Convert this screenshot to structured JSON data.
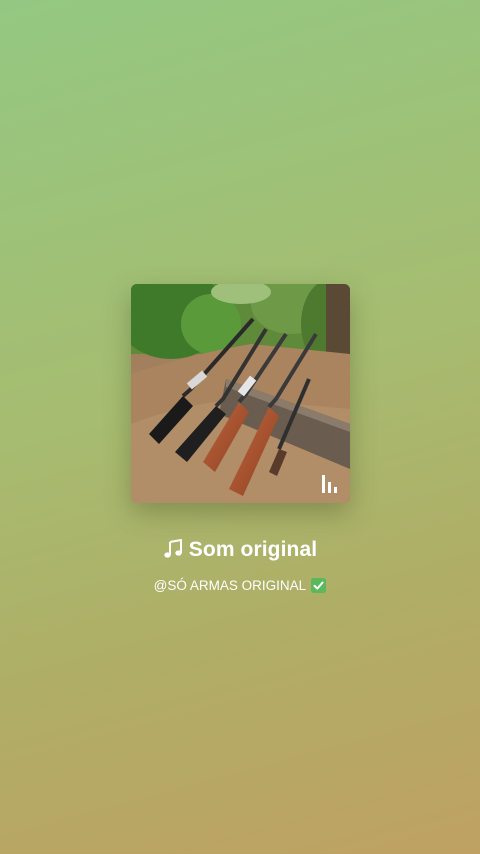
{
  "audio": {
    "title": "Som original",
    "author": "@SÓ ARMAS ORIGINAL"
  },
  "icons": {
    "title_icon": "music-note-icon",
    "verified_icon": "check-mark-button-icon",
    "cover_watermark": "kwai-logo-icon"
  },
  "colors": {
    "text": "#ffffff",
    "check_green": "#5cb85c"
  }
}
